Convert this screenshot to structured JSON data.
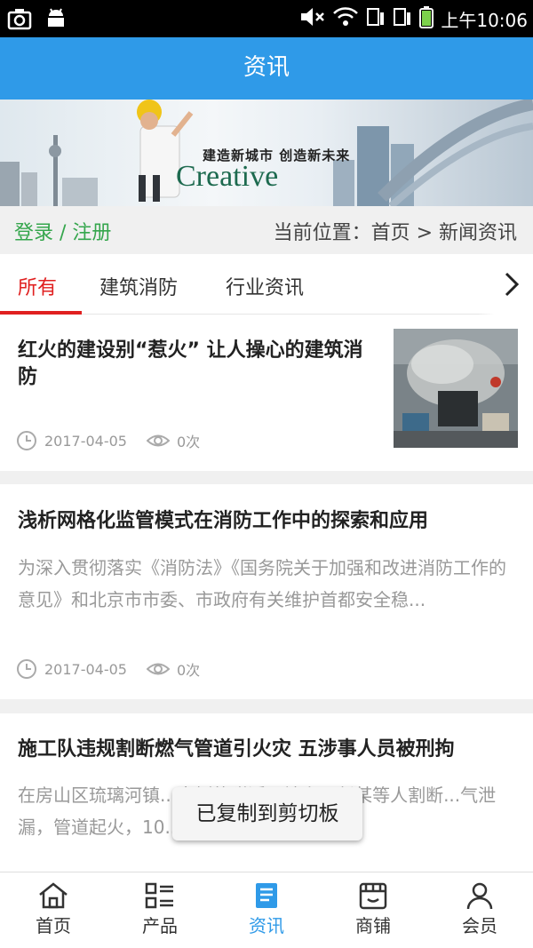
{
  "status_bar": {
    "time": "上午10:06"
  },
  "header": {
    "title": "资讯"
  },
  "banner": {
    "slogan": "建造新城市 创造新未来",
    "brand_text": "Creative"
  },
  "location_bar": {
    "login_register": "登录 / 注册",
    "breadcrumb": "当前位置：首页 > 新闻资讯"
  },
  "tabs": [
    {
      "label": "所有",
      "active": true
    },
    {
      "label": "建筑消防",
      "active": false
    },
    {
      "label": "行业资讯",
      "active": false
    }
  ],
  "articles": [
    {
      "title": "红火的建设别“惹火” 让人操心的建筑消防",
      "date": "2017-04-05",
      "views": "0次",
      "has_thumbnail": true
    },
    {
      "title": "浅析网格化监管模式在消防工作中的探索和应用",
      "summary": "为深入贯彻落实《消防法》《国务院关于加强和改进消防工作的意见》和北京市市委、市政府有关维护首都安全稳...",
      "date": "2017-04-05",
      "views": "0次"
    },
    {
      "title": "施工队违规割断燃气管道引火灾 五涉事人员被刑拘",
      "summary": "在房山区琉璃河镇...南侧的附近工地上，任某等人割断...气泄漏，管道起火，10..."
    }
  ],
  "toast": "已复制到剪切板",
  "bottom_nav": [
    {
      "label": "首页",
      "icon": "home-icon"
    },
    {
      "label": "产品",
      "icon": "grid-list-icon"
    },
    {
      "label": "资讯",
      "icon": "news-icon",
      "active": true
    },
    {
      "label": "商铺",
      "icon": "shop-icon"
    },
    {
      "label": "会员",
      "icon": "user-icon"
    }
  ],
  "colors": {
    "primary": "#2f9ae8",
    "active_tab": "#e02020",
    "login_green": "#35a64d"
  }
}
